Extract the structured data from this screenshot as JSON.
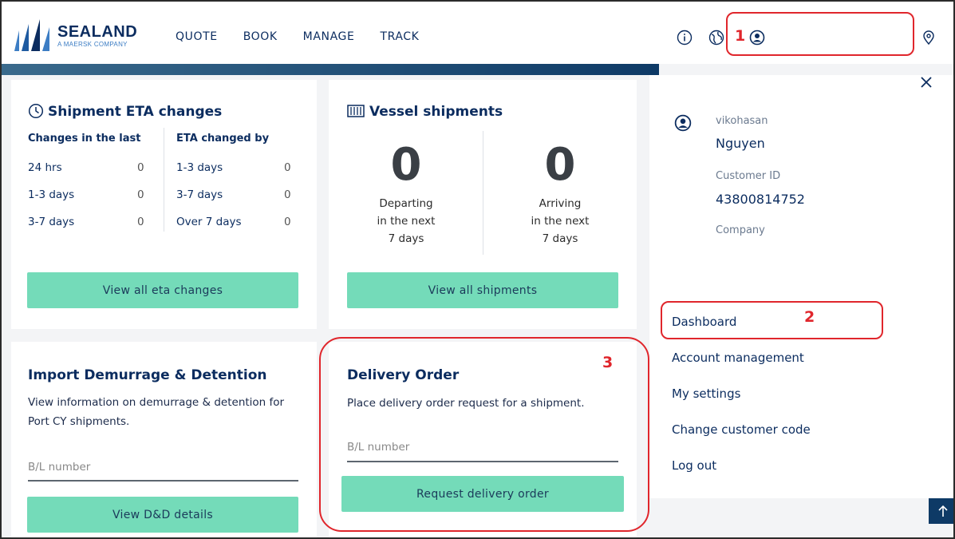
{
  "brand": {
    "name": "SEALAND",
    "sub": "A MAERSK COMPANY"
  },
  "nav": [
    "QUOTE",
    "BOOK",
    "MANAGE",
    "TRACK"
  ],
  "eta": {
    "title": "Shipment ETA changes",
    "col1_head": "Changes in the last",
    "col2_head": "ETA changed by",
    "rows1": [
      {
        "label": "24 hrs",
        "value": "0"
      },
      {
        "label": "1-3 days",
        "value": "0"
      },
      {
        "label": "3-7 days",
        "value": "0"
      }
    ],
    "rows2": [
      {
        "label": "1-3 days",
        "value": "0"
      },
      {
        "label": "3-7 days",
        "value": "0"
      },
      {
        "label": "Over 7 days",
        "value": "0"
      }
    ],
    "button": "View all eta changes"
  },
  "vessel": {
    "title": "Vessel shipments",
    "departing_count": "0",
    "departing_l1": "Departing",
    "departing_l2": "in the next",
    "departing_l3": "7 days",
    "arriving_count": "0",
    "arriving_l1": "Arriving",
    "arriving_l2": "in the next",
    "arriving_l3": "7 days",
    "button": "View all shipments"
  },
  "demurrage": {
    "title": "Import Demurrage & Detention",
    "desc1": "View information on demurrage & detention for",
    "desc2": "Port CY shipments.",
    "placeholder": "B/L number",
    "button": "View D&D details"
  },
  "delivery": {
    "title": "Delivery Order",
    "desc": "Place delivery order request for a shipment.",
    "placeholder": "B/L number",
    "button": "Request delivery order"
  },
  "profile": {
    "username": "vikohasan",
    "name": "Nguyen",
    "customer_id_label": "Customer ID",
    "customer_id": "43800814752",
    "company_label": "Company"
  },
  "menu": [
    "Dashboard",
    "Account management",
    "My settings",
    "Change customer code",
    "Log out"
  ],
  "annotations": [
    "1",
    "2",
    "3"
  ],
  "colors": {
    "accent": "#74dbb9",
    "brand": "#0b2c5f",
    "annotation": "#e0262c"
  }
}
